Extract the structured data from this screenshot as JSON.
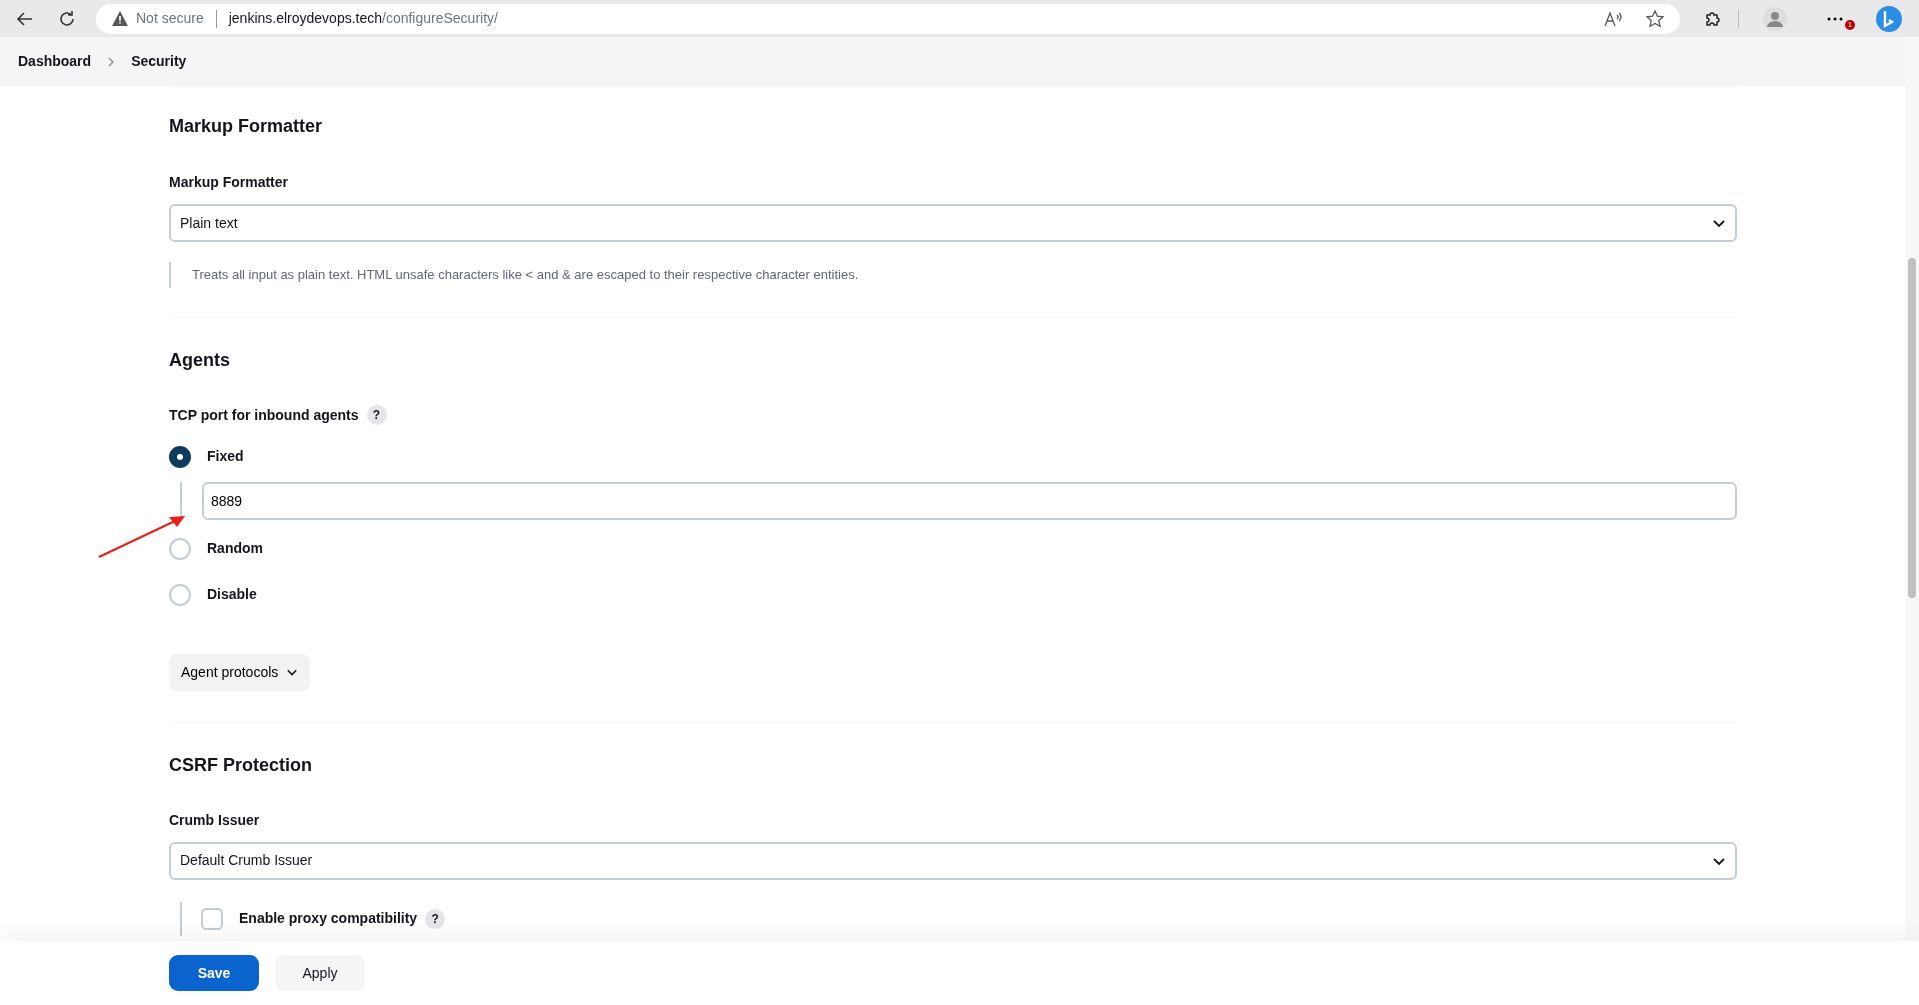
{
  "browser": {
    "security_label": "Not secure",
    "url_host": "jenkins.elroydevops.tech",
    "url_path": "/configureSecurity/",
    "notification_count": "1"
  },
  "breadcrumb": [
    {
      "label": "Dashboard"
    },
    {
      "label": "Security"
    }
  ],
  "markup_formatter": {
    "title": "Markup Formatter",
    "field_label": "Markup Formatter",
    "select_value": "Plain text",
    "help_text": "Treats all input as plain text. HTML unsafe characters like < and & are escaped to their respective character entities."
  },
  "agents": {
    "title": "Agents",
    "port_label": "TCP port for inbound agents",
    "port_help": "?",
    "port_options": [
      {
        "label": "Fixed",
        "selected": true
      },
      {
        "label": "Random",
        "selected": false
      },
      {
        "label": "Disable",
        "selected": false
      }
    ],
    "port_value": "8889",
    "protocols_button": "Agent protocols"
  },
  "csrf": {
    "title": "CSRF Protection",
    "field_label": "Crumb Issuer",
    "select_value": "Default Crumb Issuer",
    "proxy_option": {
      "label": "Enable proxy compatibility",
      "checked": false,
      "help": "?"
    }
  },
  "buttons": {
    "save": "Save",
    "apply": "Apply"
  }
}
